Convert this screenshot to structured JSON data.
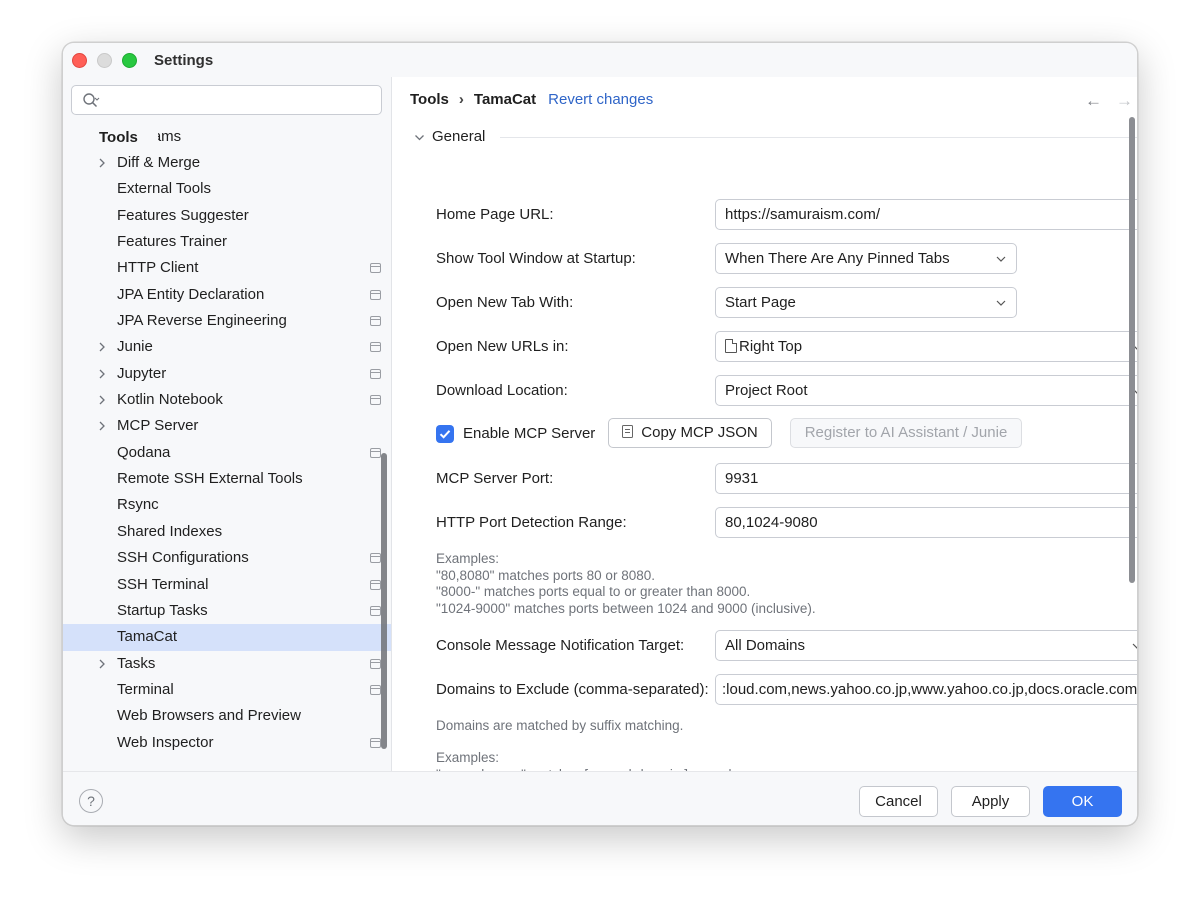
{
  "window": {
    "title": "Settings"
  },
  "sidebar": {
    "search": {
      "placeholder": "",
      "value": ""
    },
    "section_header": "Tools",
    "items": [
      {
        "label": "Diagrams",
        "expandable": false,
        "project_icon": false,
        "partial": true
      },
      {
        "label": "Diff & Merge",
        "expandable": true,
        "project_icon": false
      },
      {
        "label": "External Tools",
        "expandable": false,
        "project_icon": false
      },
      {
        "label": "Features Suggester",
        "expandable": false,
        "project_icon": false
      },
      {
        "label": "Features Trainer",
        "expandable": false,
        "project_icon": false
      },
      {
        "label": "HTTP Client",
        "expandable": false,
        "project_icon": true
      },
      {
        "label": "JPA Entity Declaration",
        "expandable": false,
        "project_icon": true
      },
      {
        "label": "JPA Reverse Engineering",
        "expandable": false,
        "project_icon": true
      },
      {
        "label": "Junie",
        "expandable": true,
        "project_icon": true
      },
      {
        "label": "Jupyter",
        "expandable": true,
        "project_icon": true
      },
      {
        "label": "Kotlin Notebook",
        "expandable": true,
        "project_icon": true
      },
      {
        "label": "MCP Server",
        "expandable": true,
        "project_icon": false
      },
      {
        "label": "Qodana",
        "expandable": false,
        "project_icon": true
      },
      {
        "label": "Remote SSH External Tools",
        "expandable": false,
        "project_icon": false
      },
      {
        "label": "Rsync",
        "expandable": false,
        "project_icon": false
      },
      {
        "label": "Shared Indexes",
        "expandable": false,
        "project_icon": false
      },
      {
        "label": "SSH Configurations",
        "expandable": false,
        "project_icon": true
      },
      {
        "label": "SSH Terminal",
        "expandable": false,
        "project_icon": true
      },
      {
        "label": "Startup Tasks",
        "expandable": false,
        "project_icon": true
      },
      {
        "label": "TamaCat",
        "expandable": false,
        "project_icon": false,
        "selected": true
      },
      {
        "label": "Tasks",
        "expandable": true,
        "project_icon": true
      },
      {
        "label": "Terminal",
        "expandable": false,
        "project_icon": true
      },
      {
        "label": "Web Browsers and Preview",
        "expandable": false,
        "project_icon": false
      },
      {
        "label": "Web Inspector",
        "expandable": false,
        "project_icon": true
      }
    ]
  },
  "main": {
    "breadcrumb": {
      "parent": "Tools",
      "separator": "›",
      "current": "TamaCat",
      "revert": "Revert changes"
    },
    "nav": {
      "back": "←",
      "forward": "→"
    },
    "section": "General",
    "fields": {
      "home_page_url": {
        "label": "Home Page URL:",
        "value": "https://samuraism.com/"
      },
      "show_tool_window": {
        "label": "Show Tool Window at Startup:",
        "value": "When There Are Any Pinned Tabs"
      },
      "open_new_tab": {
        "label": "Open New Tab With:",
        "value": "Start Page"
      },
      "open_new_urls": {
        "label": "Open New URLs in:",
        "value": "Right Top"
      },
      "download_location": {
        "label": "Download Location:",
        "value": "Project Root"
      },
      "mcp_port": {
        "label": "MCP Server Port:",
        "value": "9931"
      },
      "http_port_range": {
        "label": "HTTP Port Detection Range:",
        "value": "80,1024-9080"
      },
      "console_target": {
        "label": "Console Message Notification Target:",
        "value": "All Domains"
      },
      "domains_exclude": {
        "label": "Domains to Exclude (comma-separated):",
        "value": ":loud.com,news.yahoo.co.jp,www.yahoo.co.jp,docs.oracle.com"
      }
    },
    "mcp": {
      "enable_label": "Enable MCP Server",
      "enabled": true,
      "copy_button": "Copy MCP JSON",
      "register_button": "Register to AI Assistant / Junie"
    },
    "port_examples": "Examples:\n\"80,8080\" matches ports 80 or 8080.\n\"8000-\" matches ports equal to or greater than 8000.\n\"1024-9000\" matches ports between 1024 and 9000 (inclusive).",
    "domain_note": "Domains are matched by suffix matching.",
    "domain_examples": "Examples:\n\"example.com\" matches [any-subdomain.]example.com\n\"example.com,jetbrains.com\" matches [any-subdomain.]example.com and [any-subdomain]jetbrains.com"
  },
  "footer": {
    "help": "?",
    "cancel": "Cancel",
    "apply": "Apply",
    "ok": "OK"
  },
  "colors": {
    "accent": "#3574f0",
    "link": "#2f65c8",
    "selection": "#d5e1fa"
  }
}
